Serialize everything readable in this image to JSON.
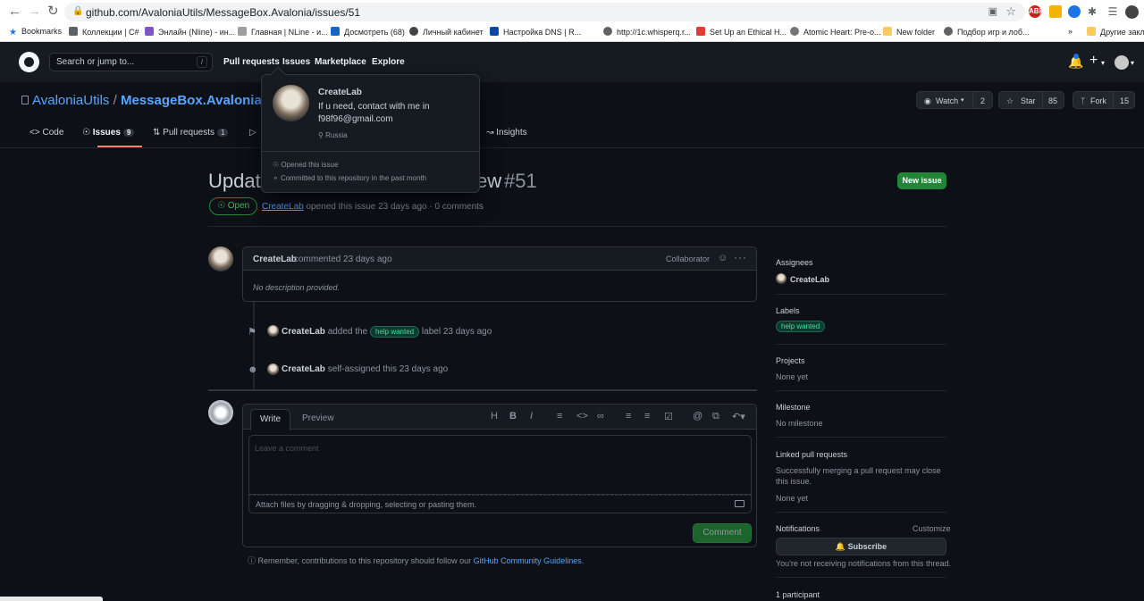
{
  "browser": {
    "url": "github.com/AvaloniaUtils/MessageBox.Avalonia/issues/51",
    "bookmarks": [
      "Bookmarks",
      "Коллекции | C#",
      "Энлайн (Nline) - ин...",
      "Главная | NLine - и...",
      "Досмотреть (68)",
      "Личный кабинет",
      "Настройка DNS | R...",
      "http://1c.whisperq.r...",
      "Set Up an Ethical H...",
      "Atomic Heart: Pre-o...",
      "New folder",
      "Подбор игр и лоб..."
    ],
    "more": "»",
    "other_bookmarks": "Другие закл"
  },
  "header": {
    "search_placeholder": "Search or jump to...",
    "search_key": "/",
    "nav": [
      "Pull requests",
      "Issues",
      "Marketplace",
      "Explore"
    ]
  },
  "repo": {
    "owner": "AvaloniaUtils",
    "separator": "/",
    "name": "MessageBox.Avalonia",
    "watch_label": "Watch",
    "watch_count": "2",
    "star_label": "Star",
    "star_count": "85",
    "fork_label": "Fork",
    "fork_count": "15"
  },
  "tabs": {
    "code": "Code",
    "issues": "Issues",
    "issues_count": "9",
    "pull_requests": "Pull requests",
    "pull_requests_count": "1",
    "insights": "Insights"
  },
  "issue": {
    "title_visible_left": "Updat",
    "title_visible_right": "ew",
    "number": "#51",
    "state": "Open",
    "author": "CreateLab",
    "meta": "opened this issue 23 days ago · 0 comments",
    "new_issue": "New issue"
  },
  "comment": {
    "author": "CreateLab",
    "when": "commented 23 days ago",
    "role": "Collaborator",
    "body": "No description provided."
  },
  "timeline": {
    "ev1_author": "CreateLab",
    "ev1_pre": "added the",
    "ev1_label": "help wanted",
    "ev1_post": "label 23 days ago",
    "ev2_author": "CreateLab",
    "ev2_text": "self-assigned this 23 days ago"
  },
  "editor": {
    "write": "Write",
    "preview": "Preview",
    "placeholder": "Leave a comment",
    "attach": "Attach files by dragging & dropping, selecting or pasting them.",
    "submit": "Comment",
    "remember_pre": "Remember, contributions to this repository should follow our",
    "remember_link": "GitHub Community Guidelines",
    "remember_post": "."
  },
  "sidebar": {
    "assignees_h": "Assignees",
    "assignee": "CreateLab",
    "labels_h": "Labels",
    "label": "help wanted",
    "projects_h": "Projects",
    "projects_v": "None yet",
    "milestone_h": "Milestone",
    "milestone_v": "No milestone",
    "linked_h": "Linked pull requests",
    "linked_desc": "Successfully merging a pull request may close this issue.",
    "linked_v": "None yet",
    "notif_h": "Notifications",
    "customize": "Customize",
    "subscribe": "Subscribe",
    "notif_v": "You're not receiving notifications from this thread.",
    "participants": "1 participant"
  },
  "hovercard": {
    "name": "CreateLab",
    "bio": "If u need, contact with me in f98f96@gmail.com",
    "location": "Russia",
    "opened": "Opened this issue",
    "committed": "Committed to this repository in the past month"
  },
  "colors": {
    "bg": "#0d1117",
    "header_bg": "#161b22",
    "accent_blue": "#58a6ff",
    "success_green": "#238636",
    "tab_underline": "#f78166"
  }
}
